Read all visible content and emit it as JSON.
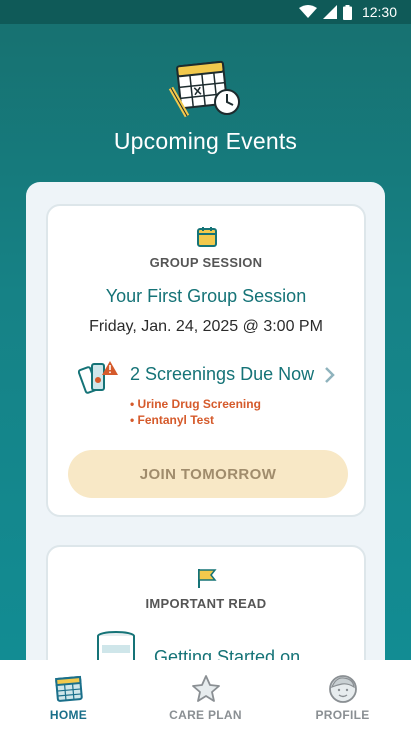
{
  "status_bar": {
    "time": "12:30"
  },
  "header": {
    "title": "Upcoming Events"
  },
  "session_card": {
    "eyebrow": "GROUP SESSION",
    "title": "Your First Group Session",
    "date": "Friday, Jan. 24, 2025 @ 3:00 PM",
    "screenings": {
      "title": "2 Screenings Due Now",
      "items": [
        "• Urine Drug Screening",
        "• Fentanyl Test"
      ]
    },
    "join_button": "JOIN TOMORROW"
  },
  "read_card": {
    "eyebrow": "IMPORTANT READ",
    "title": "Getting Started on"
  },
  "tabs": [
    {
      "label": "HOME",
      "icon": "calendar-icon",
      "active": true
    },
    {
      "label": "CARE PLAN",
      "icon": "star-icon",
      "active": false
    },
    {
      "label": "PROFILE",
      "icon": "face-icon",
      "active": false
    }
  ],
  "colors": {
    "teal": "#157377",
    "alert": "#d55a2b",
    "button_bg": "#f8e8c6",
    "calendar_yellow": "#f2c94c",
    "active_tab": "#1a6f8a"
  }
}
